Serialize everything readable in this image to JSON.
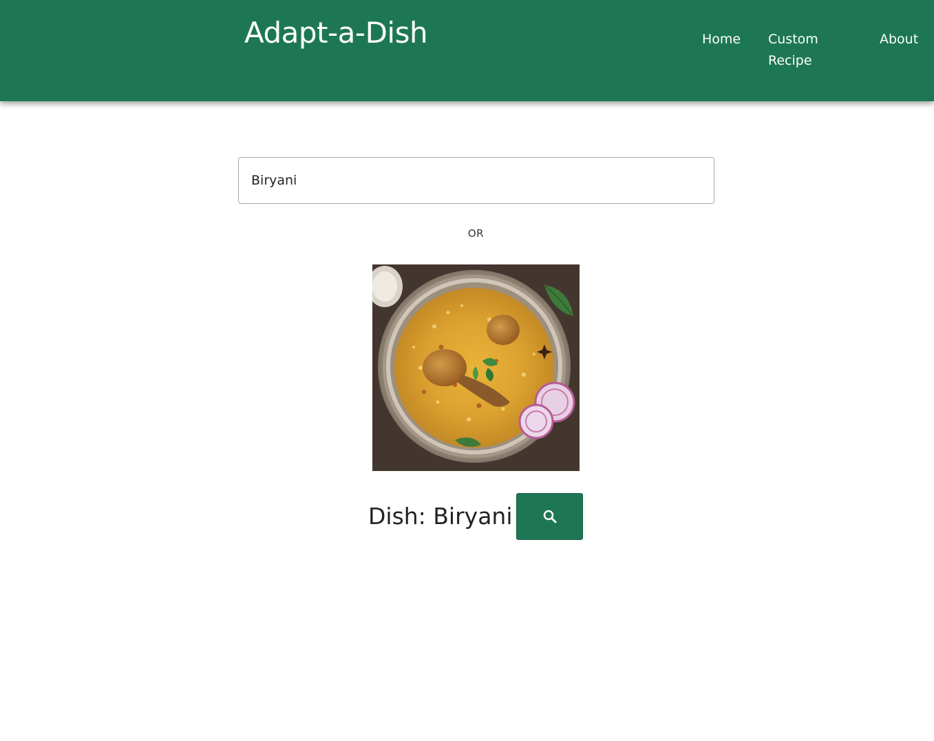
{
  "header": {
    "brand": "Adapt-a-Dish",
    "nav": {
      "home": "Home",
      "custom_recipe": "Custom Recipe",
      "about": "About"
    },
    "background_color": "#1d7754"
  },
  "search": {
    "value": "Biryani"
  },
  "divider_text": "OR",
  "dish": {
    "image_icon": "biryani-plate-photo",
    "label": "Dish: Biryani"
  },
  "search_button": {
    "icon": "search-icon",
    "color": "#1d7754"
  }
}
